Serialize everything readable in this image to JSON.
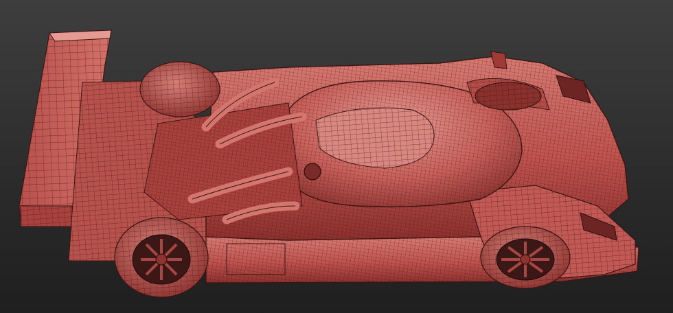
{
  "scene": {
    "subject": "wireframe-race-car",
    "colors": {
      "background_top": "#3e3e3e",
      "background_bottom": "#1f1f1f",
      "body_base": "#c95a55",
      "body_light": "#e2918a",
      "body_dark": "#8a2f2d",
      "wire": "#3a1514",
      "tire": "#b64d48",
      "wheel_dark": "#3b1816"
    }
  }
}
